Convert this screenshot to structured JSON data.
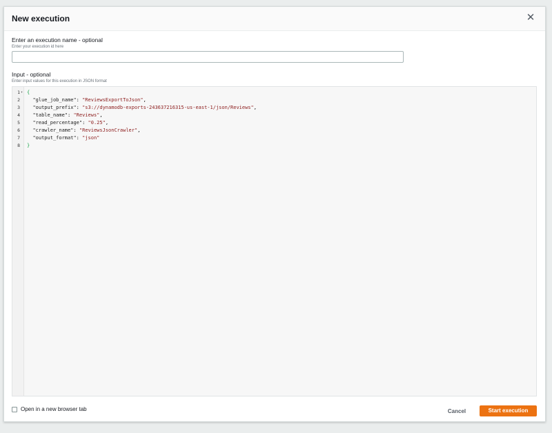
{
  "dialog": {
    "title": "New execution",
    "close_icon": "close-icon"
  },
  "name_field": {
    "label": "Enter an execution name - optional",
    "description": "Enter your execution id here",
    "value": "",
    "placeholder": ""
  },
  "input_field": {
    "label": "Input - optional",
    "description": "Enter input values for this execution in JSON format",
    "line_numbers": [
      "1",
      "2",
      "3",
      "4",
      "5",
      "6",
      "7",
      "8"
    ],
    "fold_marker": "▾",
    "lines": [
      {
        "key": "",
        "value": "",
        "brace": "{"
      },
      {
        "key": "\"glue_job_name\"",
        "value": "\"ReviewsExportToJson\"",
        "sep": ": ",
        "trail": ","
      },
      {
        "key": "\"output_prefix\"",
        "value": "\"s3://dynamodb-exports-243637216315-us-east-1/json/Reviews\"",
        "sep": ": ",
        "trail": ","
      },
      {
        "key": "\"table_name\"",
        "value": "\"Reviews\"",
        "sep": ": ",
        "trail": ","
      },
      {
        "key": "\"read_percentage\"",
        "value": "\"0.25\"",
        "sep": ": ",
        "trail": ","
      },
      {
        "key": "\"crawler_name\"",
        "value": "\"ReviewsJsonCrawler\"",
        "sep": ": ",
        "trail": ","
      },
      {
        "key": "\"output_format\"",
        "value": "\"json\"",
        "sep": ": ",
        "trail": ""
      },
      {
        "key": "",
        "value": "",
        "brace": "}"
      }
    ]
  },
  "footer": {
    "checkbox_label": "Open in a new browser tab",
    "checkbox_checked": false,
    "cancel_label": "Cancel",
    "start_label": "Start execution"
  },
  "colors": {
    "primary_button": "#ec7211",
    "brace": "#1aa34a",
    "string": "#8b1a1a"
  }
}
